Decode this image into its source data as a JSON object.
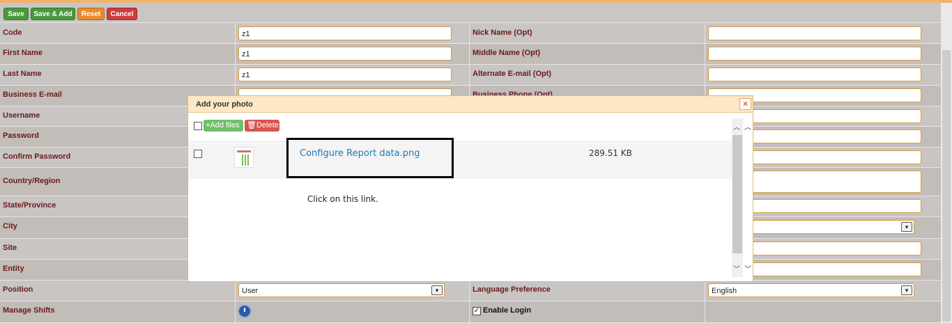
{
  "toolbar": {
    "save": "Save",
    "save_add": "Save & Add",
    "reset": "Reset",
    "cancel": "Cancel"
  },
  "form": {
    "code_label": "Code",
    "code_value": "z1",
    "nickname_label": "Nick Name (Opt)",
    "nickname_value": "",
    "firstname_label": "First Name",
    "firstname_value": "z1",
    "middlename_label": "Middle Name (Opt)",
    "middlename_value": "",
    "lastname_label": "Last Name",
    "lastname_value": "z1",
    "altemail_label": "Alternate E-mail (Opt)",
    "altemail_value": "",
    "bizemail_label": "Business E-mail",
    "bizphone_label": "Business Phone (Opt)",
    "username_label": "Username",
    "password_label": "Password",
    "confirm_label": "Confirm Password",
    "country_label": "Country/Region",
    "state_label": "State/Province",
    "city_label": "City",
    "site_label": "Site",
    "entity_label": "Entity",
    "position_label": "Position",
    "position_value": "User",
    "language_label": "Language Preference",
    "language_value": "English",
    "shifts_label": "Manage Shifts",
    "enable_login_label": "Enable Login"
  },
  "modal": {
    "title": "Add your photo",
    "close": "×",
    "add_files": "Add files",
    "delete": "Delete",
    "file_name": "Configure Report data.png",
    "file_size": "289.51 KB",
    "hint": "Click  on this link."
  },
  "icons": {
    "add": "+",
    "delete": "🗑",
    "select_arrow": "▾",
    "scroll_up": "︿",
    "scroll_down": "﹀",
    "check": "✓"
  }
}
